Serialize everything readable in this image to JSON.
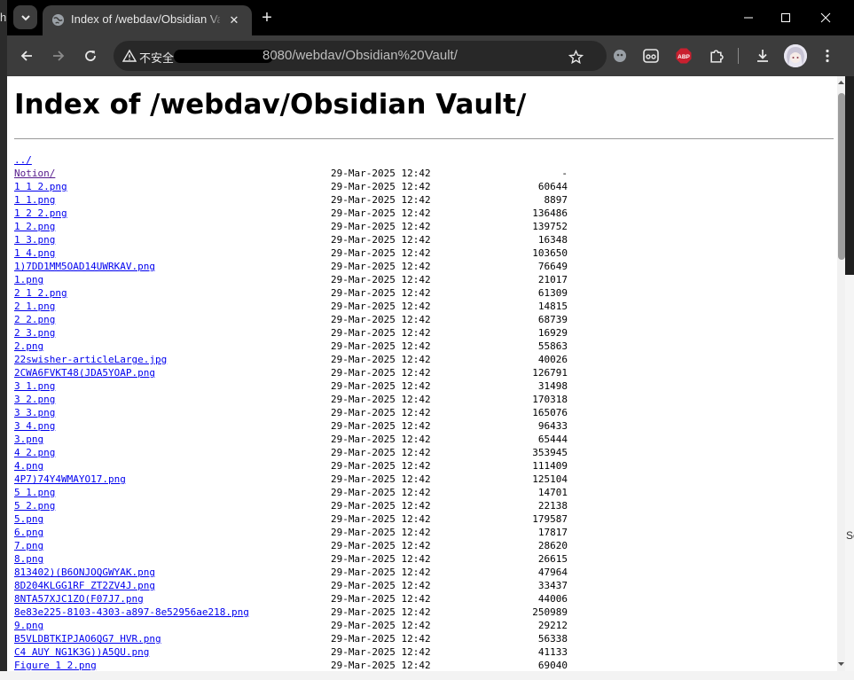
{
  "background": {
    "left_text": "h",
    "right_text": "Se"
  },
  "tab": {
    "title": "Index of /webdav/Obsidian Vault/",
    "close_glyph": "✕",
    "new_tab_glyph": "+"
  },
  "toolbar": {
    "security_label": "不安全",
    "url": "8080/webdav/Obsidian%20Vault/",
    "abp_label": "ABP"
  },
  "colors": {
    "link": "#0000ee",
    "visited_link": "#551a8b",
    "tabstrip": "#000000",
    "toolbar": "#3c3c3c",
    "abp": "#c9202f"
  },
  "icons": [
    "tab-search-icon",
    "globe-icon",
    "close-icon",
    "plus-icon",
    "minimize-icon",
    "maximize-icon",
    "window-close-icon",
    "back-arrow-icon",
    "forward-arrow-icon",
    "reload-icon",
    "warning-icon",
    "star-icon",
    "extension-icon",
    "puzzle-icon",
    "download-icon",
    "kebab-menu-icon"
  ],
  "page": {
    "heading": "Index of /webdav/Obsidian Vault/",
    "parent_link": "../",
    "entries": [
      {
        "name": "Notion/",
        "date": "29-Mar-2025 12:42",
        "size": "-",
        "visited": true
      },
      {
        "name": "1 1 2.png",
        "date": "29-Mar-2025 12:42",
        "size": "60644"
      },
      {
        "name": "1 1.png",
        "date": "29-Mar-2025 12:42",
        "size": "8897"
      },
      {
        "name": "1 2 2.png",
        "date": "29-Mar-2025 12:42",
        "size": "136486"
      },
      {
        "name": "1 2.png",
        "date": "29-Mar-2025 12:42",
        "size": "139752"
      },
      {
        "name": "1 3.png",
        "date": "29-Mar-2025 12:42",
        "size": "16348"
      },
      {
        "name": "1 4.png",
        "date": "29-Mar-2025 12:42",
        "size": "103650"
      },
      {
        "name": "1)7DD1MM5OAD14UWRKAV.png",
        "date": "29-Mar-2025 12:42",
        "size": "76649"
      },
      {
        "name": "1.png",
        "date": "29-Mar-2025 12:42",
        "size": "21017"
      },
      {
        "name": "2 1 2.png",
        "date": "29-Mar-2025 12:42",
        "size": "61309"
      },
      {
        "name": "2 1.png",
        "date": "29-Mar-2025 12:42",
        "size": "14815"
      },
      {
        "name": "2 2.png",
        "date": "29-Mar-2025 12:42",
        "size": "68739"
      },
      {
        "name": "2 3.png",
        "date": "29-Mar-2025 12:42",
        "size": "16929"
      },
      {
        "name": "2.png",
        "date": "29-Mar-2025 12:42",
        "size": "55863"
      },
      {
        "name": "22swisher-articleLarge.jpg",
        "date": "29-Mar-2025 12:42",
        "size": "40026"
      },
      {
        "name": "2CWA6FVKT48(JDA5YOAP.png",
        "date": "29-Mar-2025 12:42",
        "size": "126791"
      },
      {
        "name": "3 1.png",
        "date": "29-Mar-2025 12:42",
        "size": "31498"
      },
      {
        "name": "3 2.png",
        "date": "29-Mar-2025 12:42",
        "size": "170318"
      },
      {
        "name": "3 3.png",
        "date": "29-Mar-2025 12:42",
        "size": "165076"
      },
      {
        "name": "3 4.png",
        "date": "29-Mar-2025 12:42",
        "size": "96433"
      },
      {
        "name": "3.png",
        "date": "29-Mar-2025 12:42",
        "size": "65444"
      },
      {
        "name": "4 2.png",
        "date": "29-Mar-2025 12:42",
        "size": "353945"
      },
      {
        "name": "4.png",
        "date": "29-Mar-2025 12:42",
        "size": "111409"
      },
      {
        "name": "4P7)74Y4WMAYO17.png",
        "date": "29-Mar-2025 12:42",
        "size": "125104"
      },
      {
        "name": "5 1.png",
        "date": "29-Mar-2025 12:42",
        "size": "14701"
      },
      {
        "name": "5 2.png",
        "date": "29-Mar-2025 12:42",
        "size": "22138"
      },
      {
        "name": "5.png",
        "date": "29-Mar-2025 12:42",
        "size": "179587"
      },
      {
        "name": "6.png",
        "date": "29-Mar-2025 12:42",
        "size": "17817"
      },
      {
        "name": "7.png",
        "date": "29-Mar-2025 12:42",
        "size": "28620"
      },
      {
        "name": "8.png",
        "date": "29-Mar-2025 12:42",
        "size": "26615"
      },
      {
        "name": "813402)(B6ONJOQGWYAK.png",
        "date": "29-Mar-2025 12:42",
        "size": "47964"
      },
      {
        "name": "8D204KLGG1RF ZT2ZV4J.png",
        "date": "29-Mar-2025 12:42",
        "size": "33437"
      },
      {
        "name": "8NTA57XJC1ZO(F07J7.png",
        "date": "29-Mar-2025 12:42",
        "size": "44006"
      },
      {
        "name": "8e83e225-8103-4303-a897-8e52956ae218.png",
        "date": "29-Mar-2025 12:42",
        "size": "250989"
      },
      {
        "name": "9.png",
        "date": "29-Mar-2025 12:42",
        "size": "29212"
      },
      {
        "name": "B5VLDBTKIPJAO6QG7 HVR.png",
        "date": "29-Mar-2025 12:42",
        "size": "56338"
      },
      {
        "name": "C4 AUY NG1K3G))A5QU.png",
        "date": "29-Mar-2025 12:42",
        "size": "41133"
      },
      {
        "name": "Figure 1 2.png",
        "date": "29-Mar-2025 12:42",
        "size": "69040"
      }
    ]
  }
}
